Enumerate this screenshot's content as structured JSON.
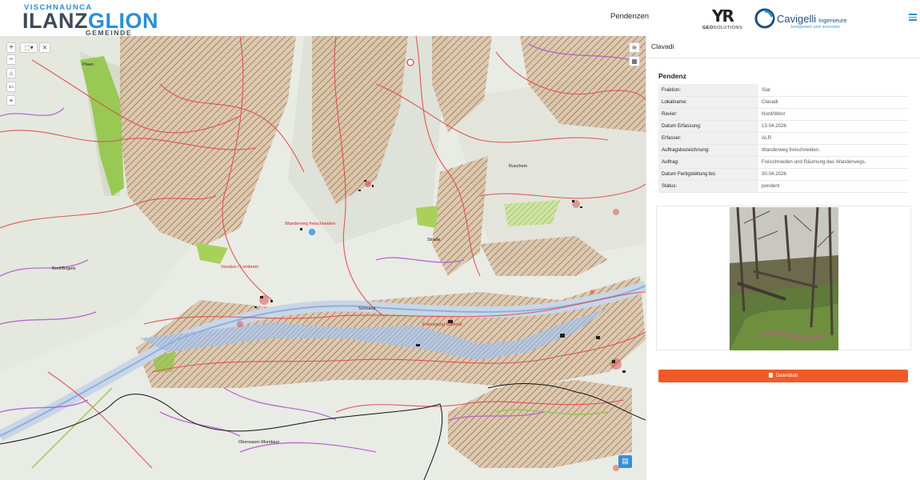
{
  "header": {
    "logo": {
      "top": "VISCHNAUNCA",
      "main_dark": "ILANZ",
      "main_blue": "GLION",
      "sub": "GEMEINDE"
    },
    "nav_pendenzen": "Pendenzen",
    "partner_yr": {
      "mark": "YR",
      "text_bold": "GEO",
      "text_rest": "SOLUTIONS"
    },
    "partner_cavigelli": {
      "name": "Cavigelli",
      "suffix": "Ingenieure",
      "tagline": "kompetent und innovativ"
    },
    "menu_icon": "hamburger-icon"
  },
  "map": {
    "controls": {
      "zoom_in": "+",
      "zoom_out": "−",
      "measure": "⌖",
      "clear": "⨯"
    },
    "labels": {
      "piz_a": "Plaun",
      "wanderweg": "Wanderweg freischneiden",
      "breil": "Breil/Brigels",
      "obersaxen": "Obersaxen Mundaun",
      "vorsaess": "Vorsäss / Lumbrein",
      "strada": "Strada",
      "entsorgung": "Entsorgung Material",
      "ruschein": "Ruschein",
      "schnaus": "Schnaus"
    },
    "colors": {
      "hatch": "#b0744a",
      "brown_fill": "#c9a981",
      "green": "#8dc63f",
      "red_line": "#e04848",
      "purple_line": "#b05ec8",
      "river": "#9fb8d8"
    }
  },
  "panel": {
    "title": "Clavadi",
    "section": "Pendenz",
    "rows": [
      {
        "key": "Fraktion:",
        "value": "Siat"
      },
      {
        "key": "Lokalname:",
        "value": "Clavadi"
      },
      {
        "key": "Revier:",
        "value": "Nord/West"
      },
      {
        "key": "Datum Erfassung:",
        "value": "13.04.2026"
      },
      {
        "key": "Erfasser:",
        "value": "ALR"
      },
      {
        "key": "Auftragsbezeichnung:",
        "value": "Wanderweg freischneiden."
      },
      {
        "key": "Auftrag:",
        "value": "Freischneiden und Räumung des Wanderwegs."
      },
      {
        "key": "Datum Fertigstellung bis:",
        "value": "30.04.2026"
      },
      {
        "key": "Status:",
        "value": "pendent"
      }
    ],
    "button_label": "Datenblatt",
    "button_color": "#f05a28"
  }
}
